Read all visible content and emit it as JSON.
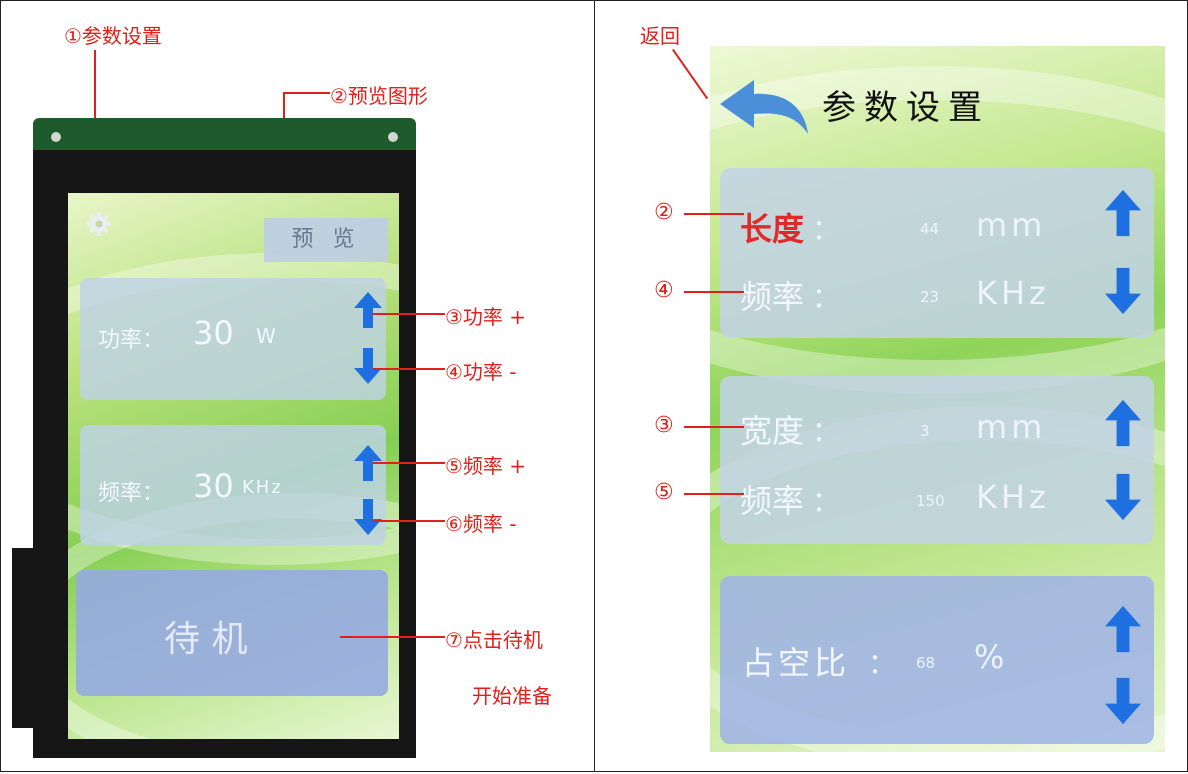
{
  "left": {
    "annotations": {
      "a1": "①参数设置",
      "a2": "②预览图形",
      "a3": "③功率 +",
      "a4": "④功率 -",
      "a5": "⑤频率 +",
      "a6": "⑥频率 -",
      "a7_line1": "⑦点击待机",
      "a7_line2": "开始准备"
    },
    "screen": {
      "preview_button": "预 览",
      "power": {
        "label": "功率：",
        "value": "30",
        "unit": "W"
      },
      "frequency": {
        "label": "频率：",
        "value": "30",
        "unit": "KHz"
      },
      "standby_button": "待  机"
    }
  },
  "right": {
    "annotations": {
      "back": "返回",
      "a2": "②",
      "a4": "④",
      "a3": "③",
      "a5": "⑤"
    },
    "screen": {
      "title": "参数设置",
      "length": {
        "label": "长度",
        "value": "44",
        "unit": "mm"
      },
      "freq1": {
        "label": "频率",
        "value": "23",
        "unit": "KHz"
      },
      "width": {
        "label": "宽度",
        "value": "3",
        "unit": "mm"
      },
      "freq2": {
        "label": "频率",
        "value": "150",
        "unit": "KHz"
      },
      "duty": {
        "label": "占空比",
        "value": "68",
        "unit": "%"
      },
      "colon": "："
    }
  },
  "colors": {
    "annotation": "#e0201a",
    "arrow": "#1e6fe0",
    "length_label": "#e02a2a"
  },
  "icons": [
    "gear-icon",
    "up-arrow-icon",
    "down-arrow-icon",
    "back-arrow-icon"
  ]
}
